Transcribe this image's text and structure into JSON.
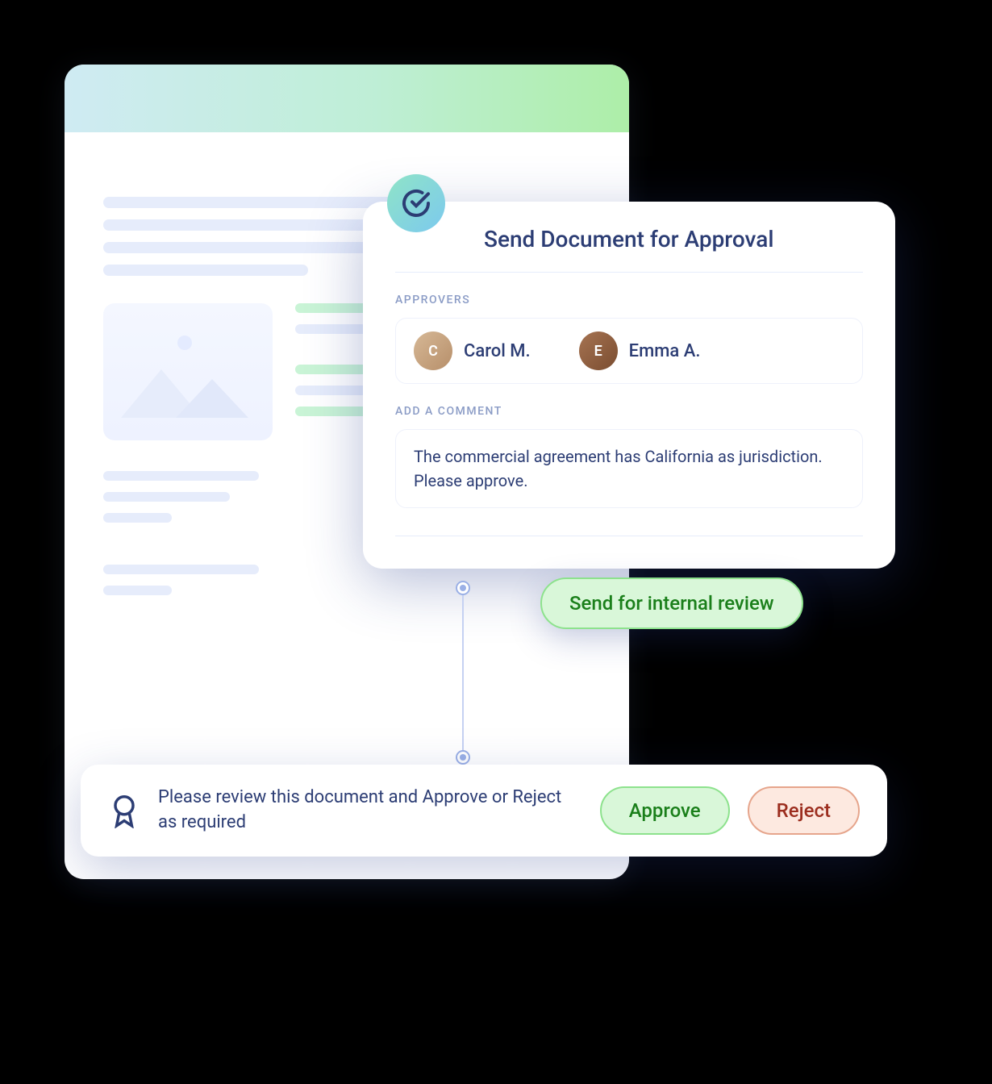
{
  "modal": {
    "title": "Send Document for Approval",
    "approvers_label": "APPROVERS",
    "approvers": [
      {
        "name": "Carol M.",
        "initials": "C"
      },
      {
        "name": "Emma A.",
        "initials": "E"
      }
    ],
    "comment_label": "ADD A COMMENT",
    "comment": "The commercial agreement has California as jurisdiction. Please approve."
  },
  "actions": {
    "send_label": "Send for internal review",
    "review_prompt": "Please review this document and Approve or Reject as required",
    "approve_label": "Approve",
    "reject_label": "Reject"
  }
}
